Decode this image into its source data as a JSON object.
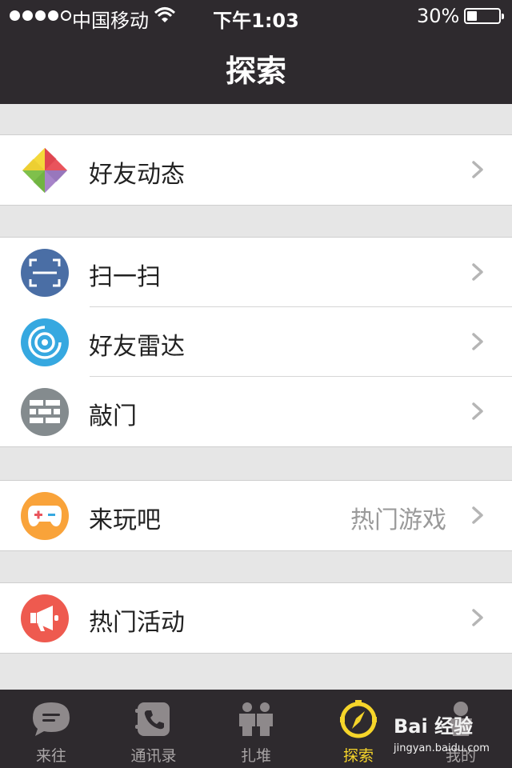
{
  "status_bar": {
    "carrier": "中国移动",
    "time": "下午1:03",
    "battery": "30%"
  },
  "header": {
    "title": "探索"
  },
  "groups": [
    {
      "items": [
        {
          "label": "好友动态",
          "icon": "pinwheel-icon"
        }
      ]
    },
    {
      "items": [
        {
          "label": "扫一扫",
          "icon": "scan-icon",
          "icon_color": "#4a6ea5"
        },
        {
          "label": "好友雷达",
          "icon": "radar-icon",
          "icon_color": "#36a8e0"
        },
        {
          "label": "敲门",
          "icon": "brick-wall-icon",
          "icon_color": "#848b8e"
        }
      ]
    },
    {
      "items": [
        {
          "label": "来玩吧",
          "detail": "热门游戏",
          "icon": "gamepad-icon",
          "icon_color": "#f9a33a"
        }
      ]
    },
    {
      "items": [
        {
          "label": "热门活动",
          "icon": "megaphone-icon",
          "icon_color": "#ee5a4f"
        }
      ]
    }
  ],
  "tabs": [
    {
      "label": "来往",
      "icon": "chat-bubble-icon"
    },
    {
      "label": "通讯录",
      "icon": "contacts-phone-icon"
    },
    {
      "label": "扎堆",
      "icon": "people-group-icon"
    },
    {
      "label": "探索",
      "icon": "compass-icon",
      "active": true
    },
    {
      "label": "我的",
      "icon": "person-icon"
    }
  ],
  "watermark": {
    "brand": "Bai 经验",
    "site": "jingyan.baidu.com"
  },
  "colors": {
    "bar_bg": "#2e2a2e",
    "page_bg": "#e6e6e6",
    "active_tab": "#f6d52a",
    "tab_inactive": "#a9a5a6"
  }
}
